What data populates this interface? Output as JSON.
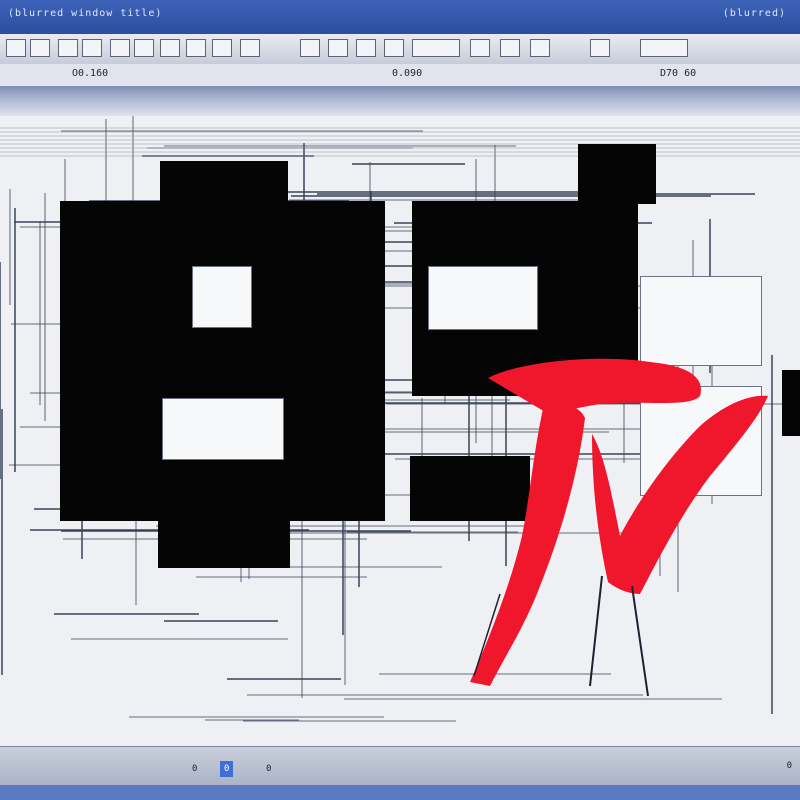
{
  "window": {
    "title_left": "(blurred window title)",
    "title_right": "(blurred)"
  },
  "toolbar": {
    "buttons": [
      "",
      "",
      "",
      "",
      "",
      "",
      "",
      "",
      "",
      "",
      "",
      "",
      "",
      "",
      "",
      "",
      "",
      "",
      "",
      ""
    ]
  },
  "formula_bar": {
    "left_text": "O0.160",
    "mid_text": "0.090",
    "right_text": "D70 60"
  },
  "canvas": {
    "panels": [
      {
        "title": ""
      },
      {
        "title": ""
      },
      {
        "title": ""
      },
      {
        "title": ""
      },
      {
        "title": ""
      }
    ],
    "logo_mark": {
      "color": "#f0162b",
      "name": "red-brush-mark"
    }
  },
  "statusbar": {
    "tabs": [
      "0",
      "0",
      "0"
    ],
    "active_index": 1,
    "right_text": "0"
  },
  "colors": {
    "title_blue": "#2b4ea0",
    "mark_red": "#f0162b",
    "block_black": "#050505",
    "status_blue": "#3f6ed6"
  }
}
